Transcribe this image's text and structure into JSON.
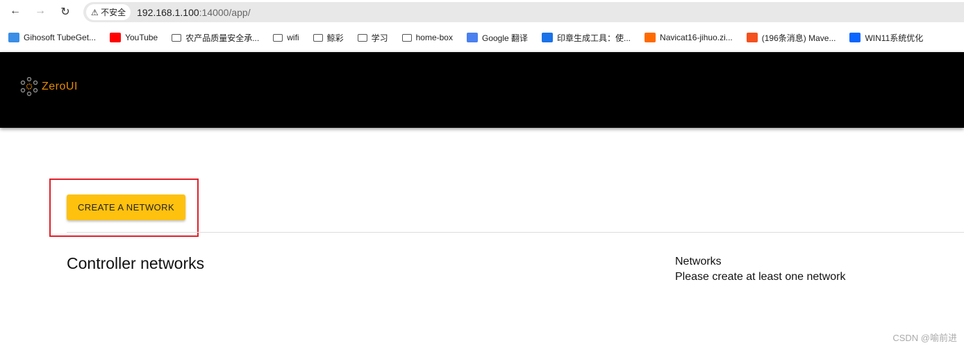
{
  "browser": {
    "url_host": "192.168.1.100",
    "url_path": ":14000/app/",
    "security_label": "不安全",
    "bookmarks": [
      {
        "label": "Gihosoft TubeGet...",
        "icon": "gihosoft-icon",
        "color": "#3a8ee6"
      },
      {
        "label": "YouTube",
        "icon": "youtube-icon",
        "color": "#ff0000"
      },
      {
        "label": "农产品质量安全承...",
        "icon": "folder-icon"
      },
      {
        "label": "wifi",
        "icon": "folder-icon"
      },
      {
        "label": "鲸彩",
        "icon": "folder-icon"
      },
      {
        "label": "学习",
        "icon": "folder-icon"
      },
      {
        "label": "home-box",
        "icon": "folder-icon"
      },
      {
        "label": "Google 翻译",
        "icon": "google-translate-icon",
        "color": "#4a80f0"
      },
      {
        "label": "印章生成工具：使...",
        "icon": "seal-tool-icon",
        "color": "#1a73e8"
      },
      {
        "label": "Navicat16-jihuo.zi...",
        "icon": "navicat-icon",
        "color": "#ff6a00"
      },
      {
        "label": "(196条消息) Mave...",
        "icon": "csdn-icon",
        "color": "#f4511e"
      },
      {
        "label": "WIN11系统优化",
        "icon": "zhihu-icon",
        "color": "#0a66ff"
      }
    ]
  },
  "header": {
    "logo_text": "ZeroUI"
  },
  "main": {
    "create_button": "CREATE A NETWORK",
    "title": "Controller networks",
    "networks_label": "Networks",
    "networks_empty": "Please create at least one network"
  },
  "watermark": "CSDN @喻前进",
  "colors": {
    "accent": "#fec10e",
    "logo": "#e68a00",
    "highlight_box": "#e0202a"
  }
}
